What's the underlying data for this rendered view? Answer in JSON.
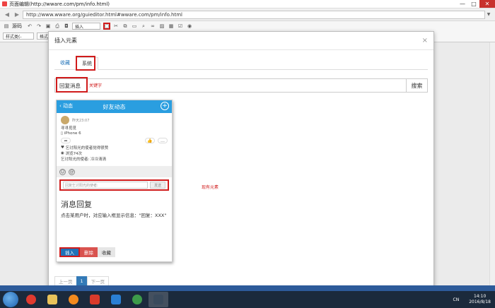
{
  "window": {
    "title": "页面编辑(http://wware.com/pm/info.html)",
    "minimize": "—",
    "maximize": "□",
    "close": "✕"
  },
  "addressbar": {
    "back": "◀",
    "forward": "▶",
    "url": "http://www.wware.org/guieditor.html#wware.com/pm/info.html"
  },
  "toolbar": {
    "source_label": "源码",
    "insert_select": "插入",
    "style_select": "样式类(-",
    "format_select": "格式"
  },
  "modal": {
    "title": "插入元素",
    "close": "×",
    "tabs": [
      {
        "label": "收藏"
      },
      {
        "label": "系统"
      }
    ],
    "search": {
      "value": "回复消息",
      "button": "搜索",
      "annotation": "关键字"
    },
    "card": {
      "header_back": "动态",
      "header_title": "好友动态",
      "header_plus": "+",
      "post_time": "昨天23:07",
      "post_text": "寻寻觅觅",
      "post_device": "iPhone 6",
      "likes": "乞讨阳光的使者觉得很赞",
      "views": "浏览74次",
      "comment": "乞讨阳光的使者: 冷冷清清",
      "reply_placeholder": "回复乞讨阳光的使者:",
      "reply_send": "发送",
      "name": "消息回复",
      "description": "点击某用户时，对应输入框显示信息：\"回复：XXX\"",
      "btn_insert": "插入",
      "btn_delete": "删除",
      "btn_fav": "收藏"
    },
    "existing_note": "现有元素",
    "pager": {
      "prev": "上一页",
      "current": "1",
      "next": "下一页"
    }
  },
  "taskbar": {
    "ime": "CN",
    "time": "14:10",
    "date": "2016/8/18"
  },
  "colors": {
    "accent": "#1f72b8",
    "highlight": "#d01b1b",
    "phone_header": "#2a9ee0",
    "danger": "#d9534f"
  }
}
